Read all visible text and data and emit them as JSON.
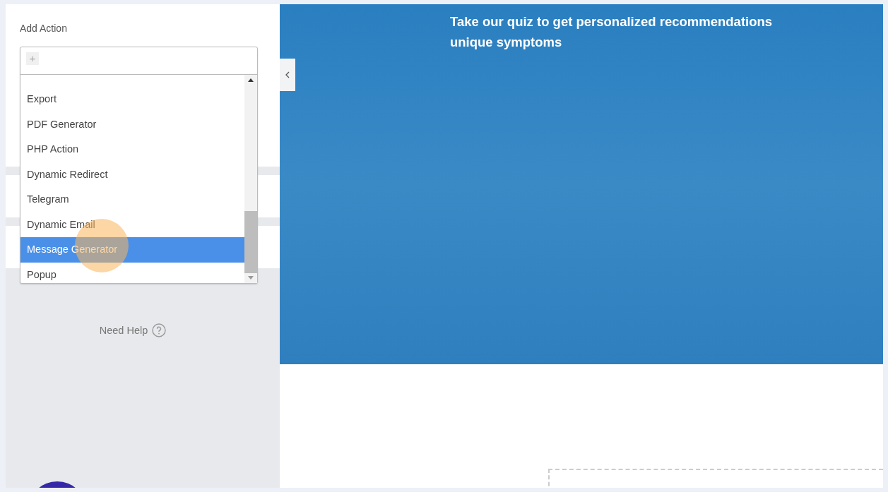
{
  "sidebar": {
    "add_action": {
      "label": "Add Action",
      "search": {
        "placeholder": "+"
      },
      "options": [
        {
          "label": "Export",
          "selected": false
        },
        {
          "label": "PDF Generator",
          "selected": false
        },
        {
          "label": "PHP Action",
          "selected": false
        },
        {
          "label": "Dynamic Redirect",
          "selected": false
        },
        {
          "label": "Telegram",
          "selected": false
        },
        {
          "label": "Dynamic Email",
          "selected": false
        },
        {
          "label": "Message Generator",
          "selected": true
        },
        {
          "label": "Popup",
          "selected": false
        }
      ]
    },
    "help": {
      "label": "Need Help"
    }
  },
  "hero": {
    "headline_lines": [
      "Take our quiz to get personalized recommendations",
      "unique symptoms"
    ]
  }
}
